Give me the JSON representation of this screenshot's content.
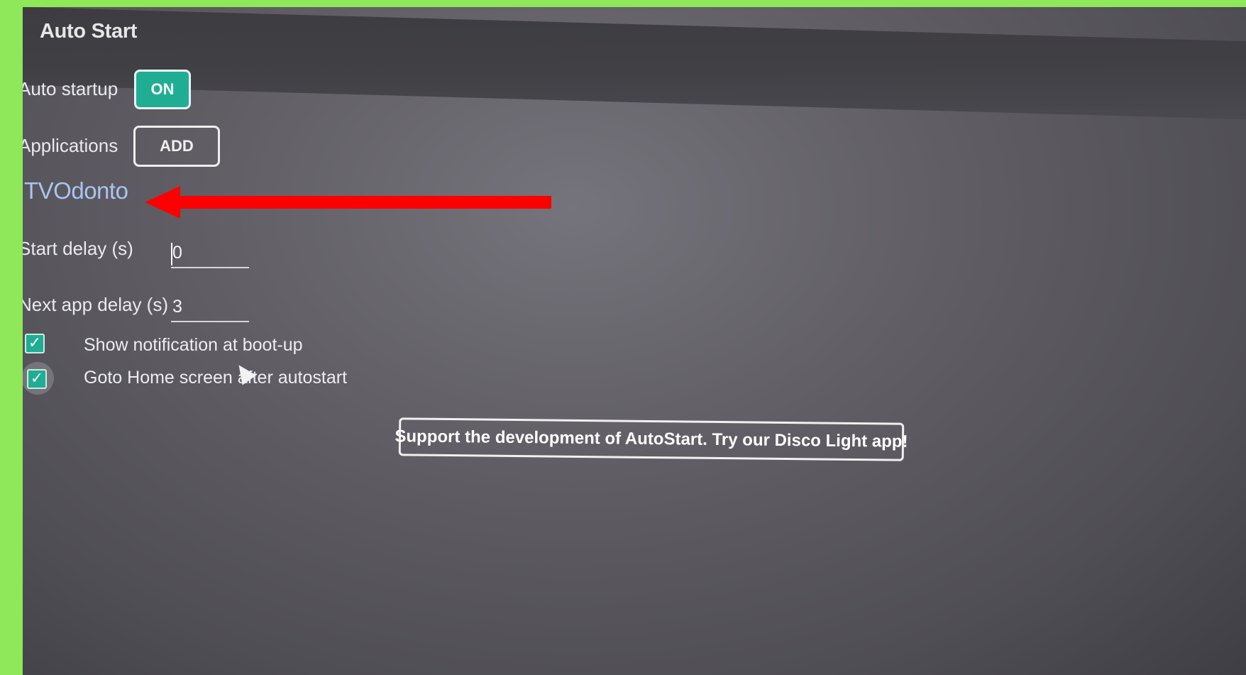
{
  "app": {
    "title": "Auto Start"
  },
  "settings": {
    "auto_startup": {
      "label": "Auto startup",
      "value": "ON"
    },
    "applications": {
      "label": "Applications",
      "button": "ADD",
      "items": [
        "TVOdonto"
      ]
    },
    "start_delay": {
      "label": "Start delay (s)",
      "value": "0"
    },
    "next_app_delay": {
      "label": "Next app delay (s)",
      "value": "3"
    },
    "checkboxes": [
      {
        "label": "Show notification at boot-up",
        "checked": true
      },
      {
        "label": "Goto Home screen after autostart",
        "checked": true
      }
    ]
  },
  "promo": {
    "label": "Support the development of AutoStart. Try our Disco Light app!"
  },
  "annotation": {
    "arrow_color": "#ff0000"
  },
  "colors": {
    "accent": "#1fae94",
    "app_item": "#a9c4f2",
    "frame": "#8ee85a"
  },
  "icons": [
    "check-icon",
    "mouse-cursor-icon",
    "red-arrow-icon"
  ]
}
